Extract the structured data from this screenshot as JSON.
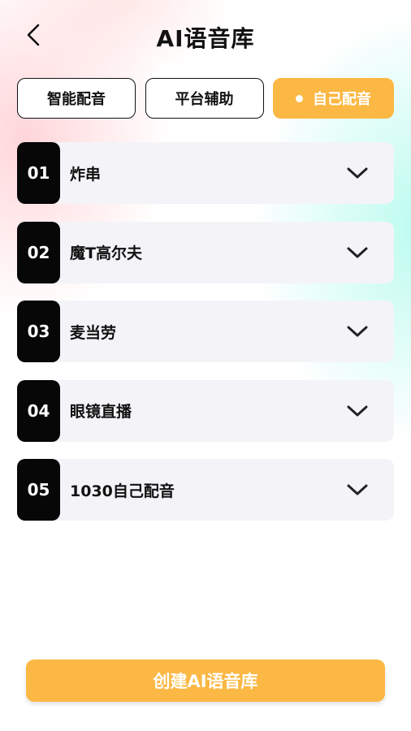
{
  "header": {
    "title": "AI语音库",
    "back_icon": "chevron-left-icon"
  },
  "tabs": [
    {
      "label": "智能配音",
      "active": false
    },
    {
      "label": "平台辅助",
      "active": false
    },
    {
      "label": "自己配音",
      "active": true
    }
  ],
  "voice_list": [
    {
      "index": "01",
      "name": "炸串"
    },
    {
      "index": "02",
      "name": "魔T高尔夫"
    },
    {
      "index": "03",
      "name": "麦当劳"
    },
    {
      "index": "04",
      "name": "眼镜直播"
    },
    {
      "index": "05",
      "name": "1030自己配音"
    }
  ],
  "create_button": {
    "label": "创建AI语音库"
  },
  "colors": {
    "accent": "#fbb844",
    "index_badge": "#070707",
    "item_bg": "#f4f4f8"
  }
}
